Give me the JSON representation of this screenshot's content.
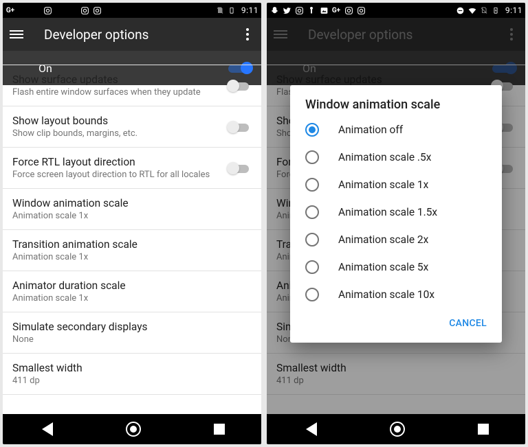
{
  "status": {
    "time": "9:11"
  },
  "appbar": {
    "title": "Developer options"
  },
  "master": {
    "label": "On",
    "enabled": true
  },
  "rows": {
    "surface": {
      "title": "Show surface updates",
      "sub": "Flash entire window surfaces when they update"
    },
    "layout": {
      "title": "Show layout bounds",
      "sub": "Show clip bounds, margins, etc."
    },
    "rtl": {
      "title": "Force RTL layout direction",
      "sub": "Force screen layout direction to RTL for all locales"
    },
    "winanim": {
      "title": "Window animation scale",
      "sub": "Animation scale 1x"
    },
    "transanim": {
      "title": "Transition animation scale",
      "sub": "Animation scale 1x"
    },
    "durscale": {
      "title": "Animator duration scale",
      "sub": "Animation scale 1x"
    },
    "simdisp": {
      "title": "Simulate secondary displays",
      "sub": "None"
    },
    "smallw": {
      "title": "Smallest width",
      "sub": "411 dp"
    }
  },
  "dialog": {
    "title": "Window animation scale",
    "options": [
      "Animation off",
      "Animation scale .5x",
      "Animation scale 1x",
      "Animation scale 1.5x",
      "Animation scale 2x",
      "Animation scale 5x",
      "Animation scale 10x"
    ],
    "selected_index": 0,
    "cancel": "Cancel"
  }
}
